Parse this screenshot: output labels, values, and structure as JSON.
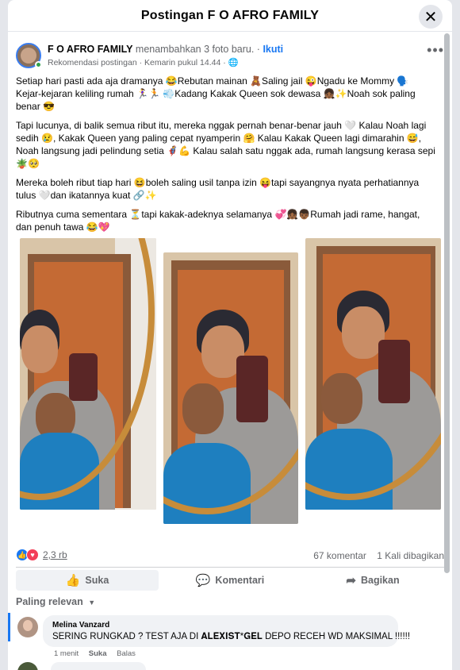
{
  "modal": {
    "title": "Postingan F O AFRO FAMILY",
    "close_icon": "close-icon"
  },
  "post": {
    "author": "F O AFRO FAMILY",
    "action": "menambahkan 3 foto baru.",
    "separator": "·",
    "follow": "Ikuti",
    "recommended": "Rekomendasi postingan",
    "time": "Kemarin pukul 14.44",
    "audience_icon": "globe-icon",
    "more_icon": "more-options-icon",
    "paragraphs": [
      "Setiap hari pasti ada aja dramanya 😂Rebutan mainan 🧸Saling jail 😜Ngadu ke Mommy 🗣️ Kejar-kejaran keliling rumah 🏃‍♀️🏃 💨Kadang Kakak Queen sok dewasa 👧🏾✨Noah sok paling benar 😎",
      "Tapi lucunya, di balik semua ribut itu, mereka nggak pernah benar-benar jauh 🤍 Kalau Noah lagi sedih 😢, Kakak Queen yang paling cepat nyamperin 🤗 Kalau Kakak Queen lagi dimarahin 😅, Noah langsung jadi pelindung setia 🦸💪 Kalau salah satu nggak ada, rumah langsung kerasa sepi 🪴🥺",
      "Mereka boleh ribut tiap hari 😆boleh saling usil tanpa izin 😝tapi sayangnya nyata perhatiannya tulus 🤍dan ikatannya kuat 🔗✨",
      "Ributnya cuma sementara ⏳tapi kakak-adeknya selamanya 💞👧🏾👦🏾Rumah jadi rame, hangat, dan penuh tawa 😂💖"
    ]
  },
  "stats": {
    "reaction_count": "2,3 rb",
    "comments": "67 komentar",
    "shares": "1 Kali dibagikan"
  },
  "actions": {
    "like": "Suka",
    "comment": "Komentari",
    "share": "Bagikan"
  },
  "sort": {
    "label": "Paling relevan"
  },
  "comment": {
    "name": "Melina Vanzard",
    "text": "SERING RUNGKAD ? TEST AJA DI 𝐀𝐋𝐄𝐗𝐈𝐒𝐓*𝐆𝐄𝐋 DEPO RECEH WD MAKSIMAL !!!!!!",
    "time": "1 menit",
    "like": "Suka",
    "reply": "Balas"
  }
}
